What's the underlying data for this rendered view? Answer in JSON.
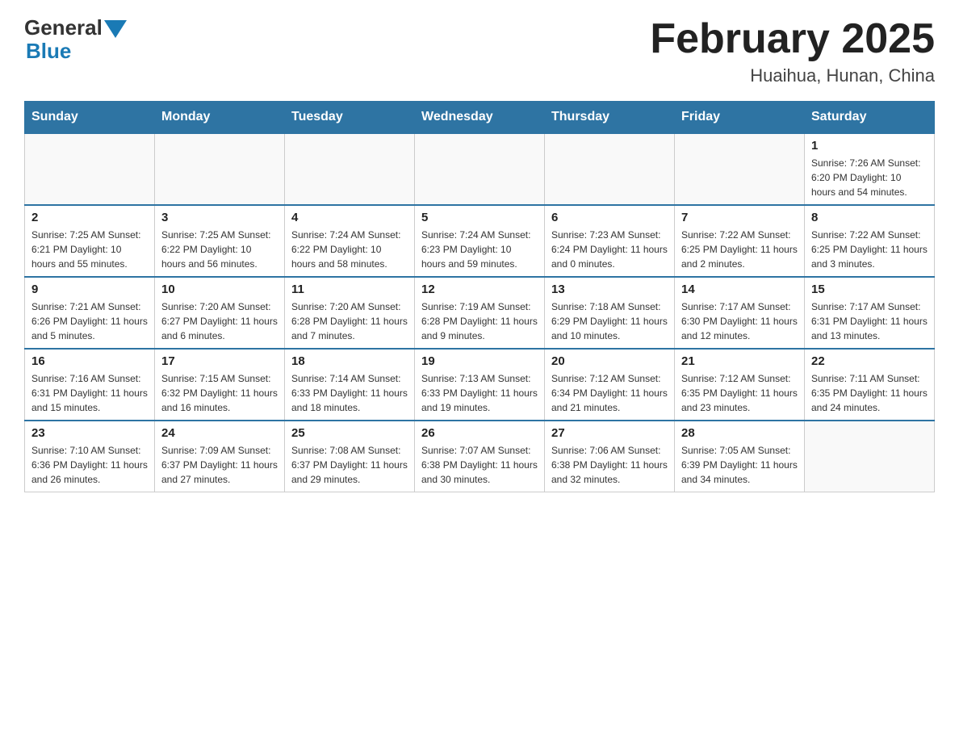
{
  "header": {
    "logo_general": "General",
    "logo_blue": "Blue",
    "title": "February 2025",
    "subtitle": "Huaihua, Hunan, China"
  },
  "days_of_week": [
    "Sunday",
    "Monday",
    "Tuesday",
    "Wednesday",
    "Thursday",
    "Friday",
    "Saturday"
  ],
  "weeks": [
    [
      {
        "day": "",
        "info": ""
      },
      {
        "day": "",
        "info": ""
      },
      {
        "day": "",
        "info": ""
      },
      {
        "day": "",
        "info": ""
      },
      {
        "day": "",
        "info": ""
      },
      {
        "day": "",
        "info": ""
      },
      {
        "day": "1",
        "info": "Sunrise: 7:26 AM\nSunset: 6:20 PM\nDaylight: 10 hours\nand 54 minutes."
      }
    ],
    [
      {
        "day": "2",
        "info": "Sunrise: 7:25 AM\nSunset: 6:21 PM\nDaylight: 10 hours\nand 55 minutes."
      },
      {
        "day": "3",
        "info": "Sunrise: 7:25 AM\nSunset: 6:22 PM\nDaylight: 10 hours\nand 56 minutes."
      },
      {
        "day": "4",
        "info": "Sunrise: 7:24 AM\nSunset: 6:22 PM\nDaylight: 10 hours\nand 58 minutes."
      },
      {
        "day": "5",
        "info": "Sunrise: 7:24 AM\nSunset: 6:23 PM\nDaylight: 10 hours\nand 59 minutes."
      },
      {
        "day": "6",
        "info": "Sunrise: 7:23 AM\nSunset: 6:24 PM\nDaylight: 11 hours\nand 0 minutes."
      },
      {
        "day": "7",
        "info": "Sunrise: 7:22 AM\nSunset: 6:25 PM\nDaylight: 11 hours\nand 2 minutes."
      },
      {
        "day": "8",
        "info": "Sunrise: 7:22 AM\nSunset: 6:25 PM\nDaylight: 11 hours\nand 3 minutes."
      }
    ],
    [
      {
        "day": "9",
        "info": "Sunrise: 7:21 AM\nSunset: 6:26 PM\nDaylight: 11 hours\nand 5 minutes."
      },
      {
        "day": "10",
        "info": "Sunrise: 7:20 AM\nSunset: 6:27 PM\nDaylight: 11 hours\nand 6 minutes."
      },
      {
        "day": "11",
        "info": "Sunrise: 7:20 AM\nSunset: 6:28 PM\nDaylight: 11 hours\nand 7 minutes."
      },
      {
        "day": "12",
        "info": "Sunrise: 7:19 AM\nSunset: 6:28 PM\nDaylight: 11 hours\nand 9 minutes."
      },
      {
        "day": "13",
        "info": "Sunrise: 7:18 AM\nSunset: 6:29 PM\nDaylight: 11 hours\nand 10 minutes."
      },
      {
        "day": "14",
        "info": "Sunrise: 7:17 AM\nSunset: 6:30 PM\nDaylight: 11 hours\nand 12 minutes."
      },
      {
        "day": "15",
        "info": "Sunrise: 7:17 AM\nSunset: 6:31 PM\nDaylight: 11 hours\nand 13 minutes."
      }
    ],
    [
      {
        "day": "16",
        "info": "Sunrise: 7:16 AM\nSunset: 6:31 PM\nDaylight: 11 hours\nand 15 minutes."
      },
      {
        "day": "17",
        "info": "Sunrise: 7:15 AM\nSunset: 6:32 PM\nDaylight: 11 hours\nand 16 minutes."
      },
      {
        "day": "18",
        "info": "Sunrise: 7:14 AM\nSunset: 6:33 PM\nDaylight: 11 hours\nand 18 minutes."
      },
      {
        "day": "19",
        "info": "Sunrise: 7:13 AM\nSunset: 6:33 PM\nDaylight: 11 hours\nand 19 minutes."
      },
      {
        "day": "20",
        "info": "Sunrise: 7:12 AM\nSunset: 6:34 PM\nDaylight: 11 hours\nand 21 minutes."
      },
      {
        "day": "21",
        "info": "Sunrise: 7:12 AM\nSunset: 6:35 PM\nDaylight: 11 hours\nand 23 minutes."
      },
      {
        "day": "22",
        "info": "Sunrise: 7:11 AM\nSunset: 6:35 PM\nDaylight: 11 hours\nand 24 minutes."
      }
    ],
    [
      {
        "day": "23",
        "info": "Sunrise: 7:10 AM\nSunset: 6:36 PM\nDaylight: 11 hours\nand 26 minutes."
      },
      {
        "day": "24",
        "info": "Sunrise: 7:09 AM\nSunset: 6:37 PM\nDaylight: 11 hours\nand 27 minutes."
      },
      {
        "day": "25",
        "info": "Sunrise: 7:08 AM\nSunset: 6:37 PM\nDaylight: 11 hours\nand 29 minutes."
      },
      {
        "day": "26",
        "info": "Sunrise: 7:07 AM\nSunset: 6:38 PM\nDaylight: 11 hours\nand 30 minutes."
      },
      {
        "day": "27",
        "info": "Sunrise: 7:06 AM\nSunset: 6:38 PM\nDaylight: 11 hours\nand 32 minutes."
      },
      {
        "day": "28",
        "info": "Sunrise: 7:05 AM\nSunset: 6:39 PM\nDaylight: 11 hours\nand 34 minutes."
      },
      {
        "day": "",
        "info": ""
      }
    ]
  ]
}
